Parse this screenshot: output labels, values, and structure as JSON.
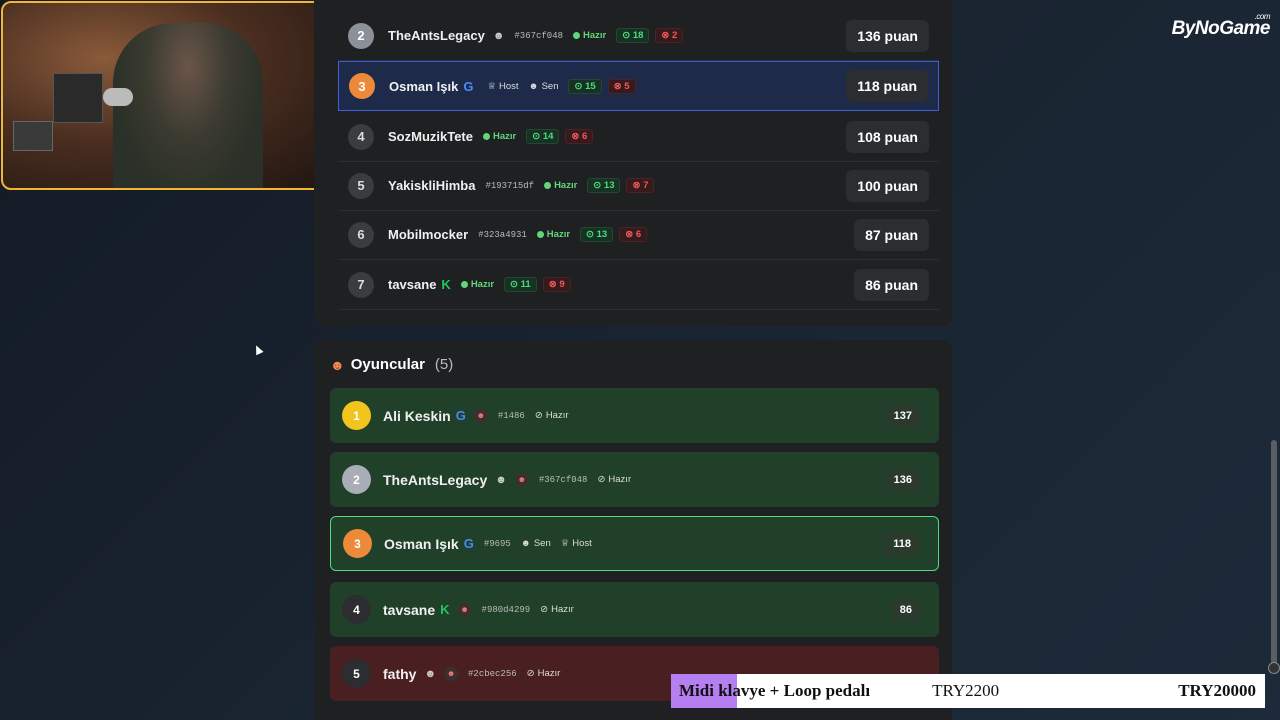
{
  "brand": {
    "name": "ByNoGame",
    "suffix": ".com"
  },
  "scoreboard": [
    {
      "rank": "2",
      "name": "TheAntsLegacy",
      "icon": "user-icon",
      "tag": "#367cf048",
      "status": "Hazır",
      "ok": "18",
      "bad": "2",
      "points": "136 puan",
      "variant": "silver"
    },
    {
      "rank": "3",
      "name": "Osman Işık",
      "icon": "google-icon",
      "host": "Host",
      "you": "Sen",
      "ok": "15",
      "bad": "5",
      "points": "118 puan",
      "variant": "bronze",
      "active": true
    },
    {
      "rank": "4",
      "name": "SozMuzikTete",
      "status": "Hazır",
      "ok": "14",
      "bad": "6",
      "points": "108 puan"
    },
    {
      "rank": "5",
      "name": "YakiskliHimba",
      "tag": "#193715df",
      "status": "Hazır",
      "ok": "13",
      "bad": "7",
      "points": "100 puan"
    },
    {
      "rank": "6",
      "name": "Mobilmocker",
      "tag": "#323a4931",
      "status": "Hazır",
      "ok": "13",
      "bad": "6",
      "points": "87 puan"
    },
    {
      "rank": "7",
      "name": "tavsane",
      "icon": "kick-icon",
      "status": "Hazır",
      "ok": "11",
      "bad": "9",
      "points": "86 puan"
    }
  ],
  "players": {
    "title": "Oyuncular",
    "count": "(5)",
    "items": [
      {
        "rank": "1",
        "name": "Ali Keskin",
        "tag": "#1486",
        "status": "Hazır",
        "score": "137"
      },
      {
        "rank": "2",
        "name": "TheAntsLegacy",
        "tag": "#367cf048",
        "status": "Hazır",
        "score": "136"
      },
      {
        "rank": "3",
        "name": "Osman Işık",
        "tag": "#9695",
        "you": "Sen",
        "host": "Host",
        "score": "118"
      },
      {
        "rank": "4",
        "name": "tavsane",
        "tag": "#980d4299",
        "status": "Hazır",
        "score": "86"
      },
      {
        "rank": "5",
        "name": "fathy",
        "tag": "#2cbec256",
        "status": "Hazır",
        "score": ""
      }
    ]
  },
  "ad": {
    "text1": "Midi klavye + Loop pedalı",
    "text2": "TRY2200",
    "text3": "TRY20000"
  },
  "colors": {
    "accent_blue": "#3a5fd9",
    "ready_green": "#62d67b",
    "wrong_red": "#f05a5a",
    "gold": "#f2c51e"
  }
}
